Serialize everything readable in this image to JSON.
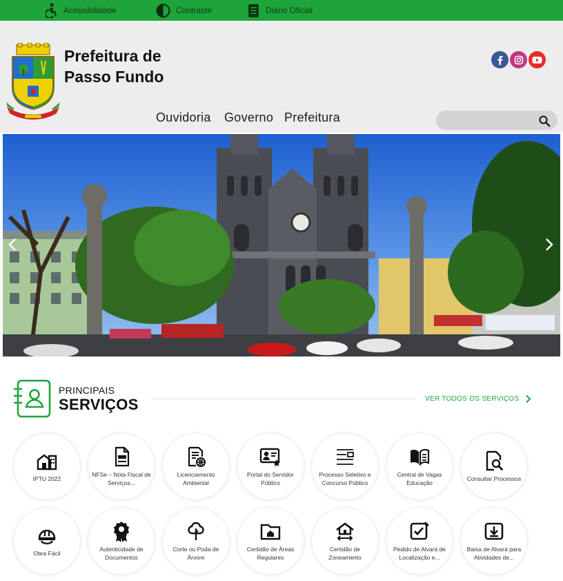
{
  "topbar": {
    "accessibility": "Acessibilidade",
    "contrast": "Contraste",
    "gazette": "Diário Oficial"
  },
  "header": {
    "brand_line1": "Prefeitura de",
    "brand_line2": "Passo Fundo",
    "social": [
      "facebook-icon",
      "instagram-icon",
      "youtube-icon"
    ],
    "search": {
      "placeholder": "",
      "value": ""
    }
  },
  "nav": {
    "items": [
      "Ouvidoria",
      "Governo",
      "Prefeitura"
    ]
  },
  "services": {
    "kicker": "PRINCIPAIS",
    "title": "SERVIÇOS",
    "see_all": "VER TODOS OS SERVIÇOS",
    "items": [
      {
        "label": "IPTU 2022",
        "icon": "house-building-icon"
      },
      {
        "label": "NFSe – Nota Fiscal de Serviços...",
        "icon": "invoice-document-icon"
      },
      {
        "label": "Licenciamento Ambiental",
        "icon": "document-globe-icon"
      },
      {
        "label": "Portal do Servidor Público",
        "icon": "id-card-star-icon"
      },
      {
        "label": "Processo Seletivo e Concurso Público",
        "icon": "list-form-icon"
      },
      {
        "label": "Central de Vagas Educação",
        "icon": "open-book-icon"
      },
      {
        "label": "Consultar Processos",
        "icon": "document-search-icon"
      },
      {
        "label": "Obra Fácil",
        "icon": "hard-hat-icon"
      },
      {
        "label": "Autenticidade de Documentos",
        "icon": "award-ribbon-icon"
      },
      {
        "label": "Corte ou Poda de Árvore",
        "icon": "tree-icon"
      },
      {
        "label": "Certidão de Áreas Regulares",
        "icon": "folder-house-icon"
      },
      {
        "label": "Certidão de Zoneamento",
        "icon": "house-arrows-icon"
      },
      {
        "label": "Pedido de Alvará de Localização e...",
        "icon": "checkbox-edit-icon"
      },
      {
        "label": "Baixa de Alvará para Atividades de...",
        "icon": "download-box-icon"
      }
    ]
  },
  "colors": {
    "primary_green": "#1ea43a",
    "header_bg": "#ededed",
    "facebook": "#3b5998",
    "instagram": "#c13584",
    "youtube": "#e52d27"
  }
}
